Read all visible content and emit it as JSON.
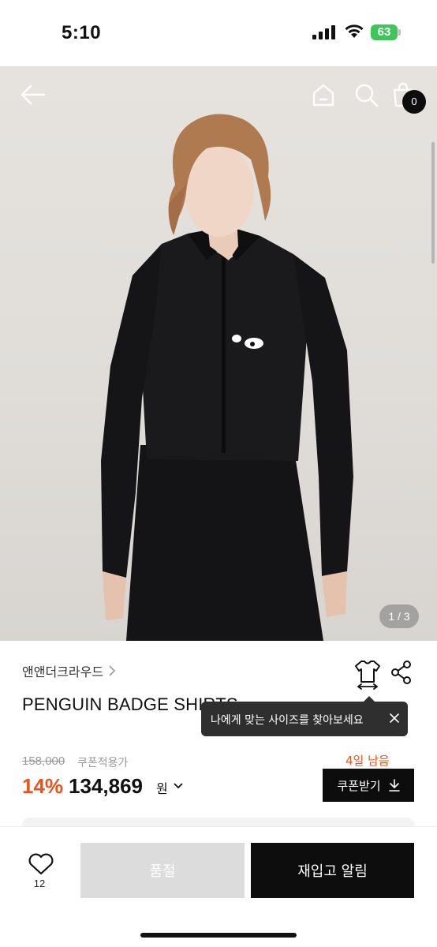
{
  "status_bar": {
    "time": "5:10",
    "battery": "63"
  },
  "hero": {
    "image_counter": "1 / 3",
    "cart_count": "0"
  },
  "product": {
    "brand": "앤앤더크라우드",
    "title": "PENGUIN BADGE SHIRTS",
    "size_tooltip": "나에게 맞는 사이즈를 찾아보세요",
    "original_price": "158,000",
    "coupon_price_label": "쿠폰적용가",
    "days_left": "4일 남음",
    "discount_rate": "14%",
    "price": "134,869",
    "currency": "원",
    "coupon_button": "쿠폰받기"
  },
  "bottom_bar": {
    "like_count": "12",
    "soldout_label": "품절",
    "restock_label": "재입고 알림"
  },
  "colors": {
    "accent": "#e8541c",
    "dark": "#0d0d0d",
    "battery": "#3fc55a",
    "soldout": "#dcdcdc"
  }
}
